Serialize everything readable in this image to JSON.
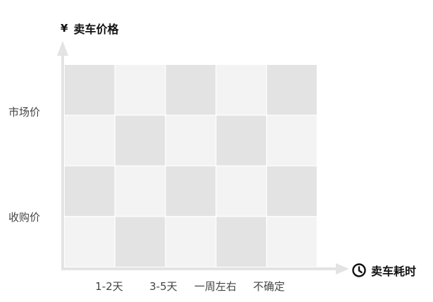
{
  "chart_data": {
    "type": "heatmap",
    "ylabel": "卖车价格",
    "xlabel": "卖车耗时",
    "y_symbol": "¥",
    "x_categories": [
      "1-2天",
      "3-5天",
      "一周左右",
      "不确定"
    ],
    "y_categories": [
      "市场价",
      "收购价"
    ],
    "grid": {
      "rows": 4,
      "cols": 5
    },
    "colors": {
      "dark": "#e3e3e3",
      "light": "#f3f3f3",
      "axis": "#e3e3e3",
      "text": "#444444",
      "title": "#111111"
    }
  },
  "icons": {
    "x_axis": "clock-icon",
    "y_axis": "yen-icon"
  }
}
